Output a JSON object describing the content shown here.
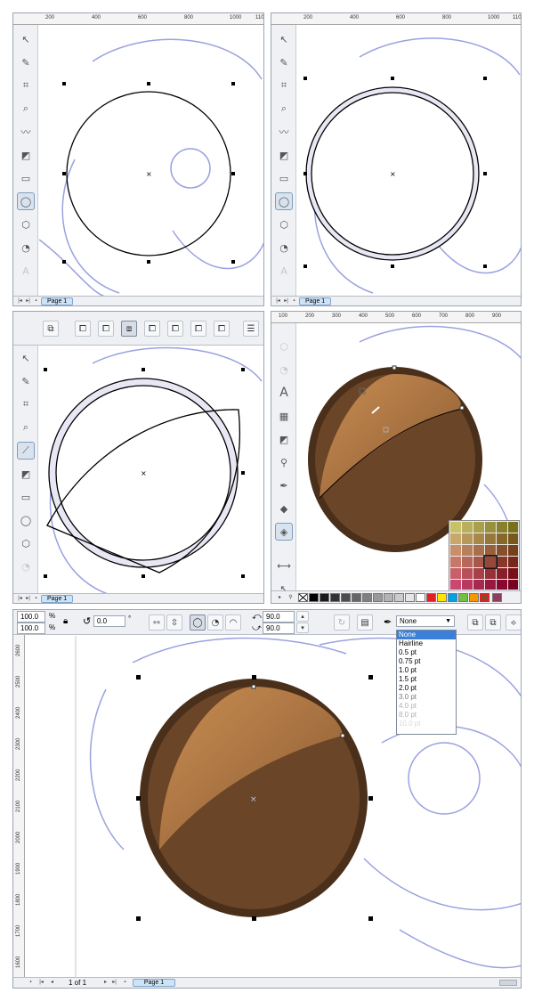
{
  "page_label": "Page 1",
  "page_count": "1 of 1",
  "top_left": {
    "ruler_ticks": [
      "200",
      "400",
      "600",
      "800",
      "1000",
      "110"
    ]
  },
  "top_right": {
    "ruler_ticks": [
      "200",
      "400",
      "600",
      "800",
      "1000",
      "110"
    ]
  },
  "bottom_right": {
    "ruler_ticks": [
      "100",
      "200",
      "300",
      "400",
      "500",
      "600",
      "700",
      "800",
      "900"
    ]
  },
  "property_bar": {
    "scale_x": "100.0",
    "scale_y": "100.0",
    "unit": "%",
    "rotation": "0.0",
    "degree_symbol": "°",
    "start_angle": "90.0",
    "end_angle": "90.0",
    "outline_width_selected": "None",
    "outline_width_options": [
      "None",
      "Hairline",
      "0.5 pt",
      "0.75 pt",
      "1.0 pt",
      "1.5 pt",
      "2.0 pt",
      "3.0 pt",
      "4.0 pt",
      "8.0 pt",
      "10.0 pt",
      "12.0 pt"
    ]
  },
  "large_panel": {
    "ruler_ticks_v": [
      "2600",
      "2500",
      "2400",
      "2300",
      "2200",
      "2100",
      "2000",
      "1900",
      "1800",
      "1700",
      "1600"
    ],
    "ruler_corner": "pixels"
  },
  "colors": {
    "shape_light": "#b97a45",
    "shape_dark": "#6b4528",
    "rim": "#4a2f1a",
    "offset_fill": "#e8e8f5",
    "sketch": "#9aa2e0",
    "selection_blue": "#3b7fd8"
  },
  "palette_colors": [
    "#000000",
    "#1a1a1a",
    "#333333",
    "#4d4d4d",
    "#666666",
    "#808080",
    "#999999",
    "#b3b3b3",
    "#cccccc",
    "#e6e6e6",
    "#ffffff",
    "#e31e24",
    "#ffe600",
    "#00a0e9",
    "#72bf44",
    "#f39800",
    "#7a4f2a",
    "#8e3d5c"
  ]
}
